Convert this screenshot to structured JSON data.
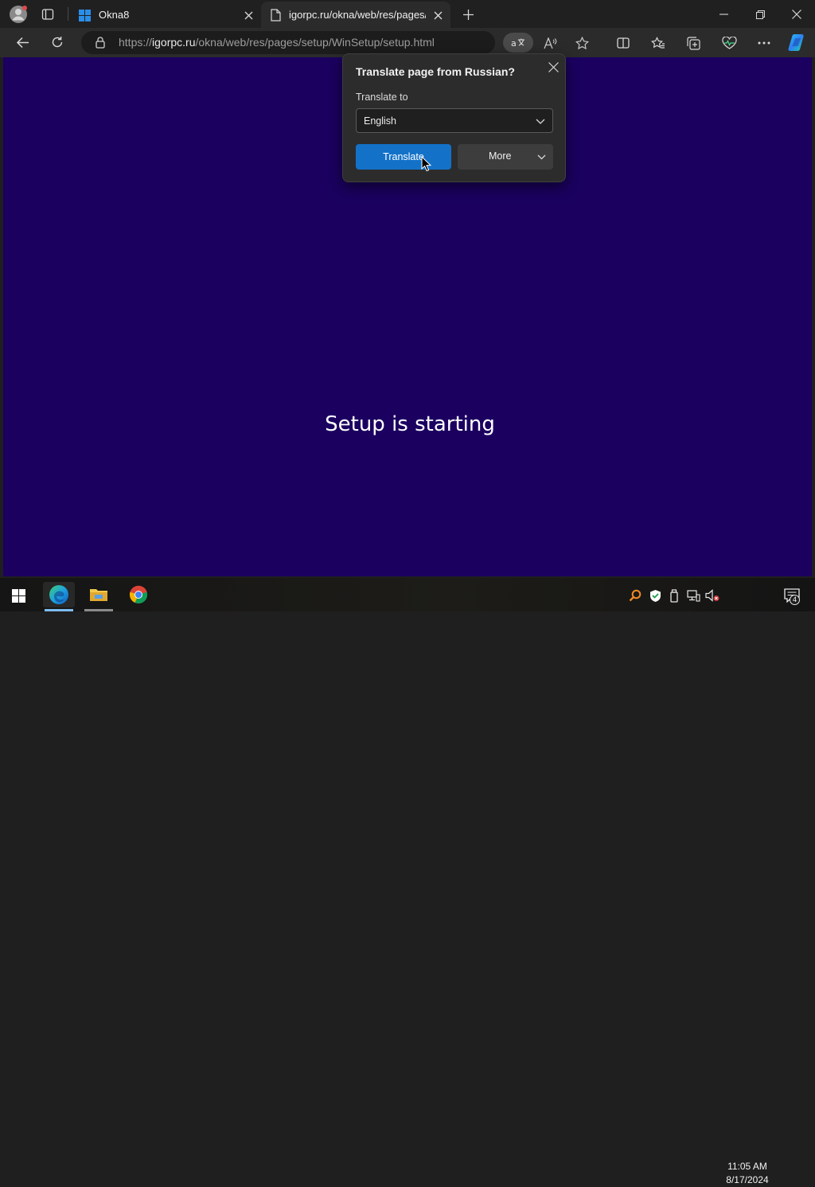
{
  "browser": {
    "tabs": [
      {
        "label": "Okna8",
        "active": false
      },
      {
        "label": "igorpc.ru/okna/web/res/pages/se",
        "active": true
      }
    ],
    "address": {
      "prefix": "https://",
      "host": "igorpc.ru",
      "path": "/okna/web/res/pages/setup/WinSetup/setup.html"
    }
  },
  "translate_popup": {
    "title": "Translate page from Russian?",
    "translate_to_label": "Translate to",
    "selected_language": "English",
    "translate_button": "Translate",
    "more_button": "More"
  },
  "page": {
    "status_text": "Setup is starting",
    "background_color": "#1b0060"
  },
  "taskbar": {
    "time": "11:05 AM",
    "date": "8/17/2024",
    "notification_count": "4"
  }
}
